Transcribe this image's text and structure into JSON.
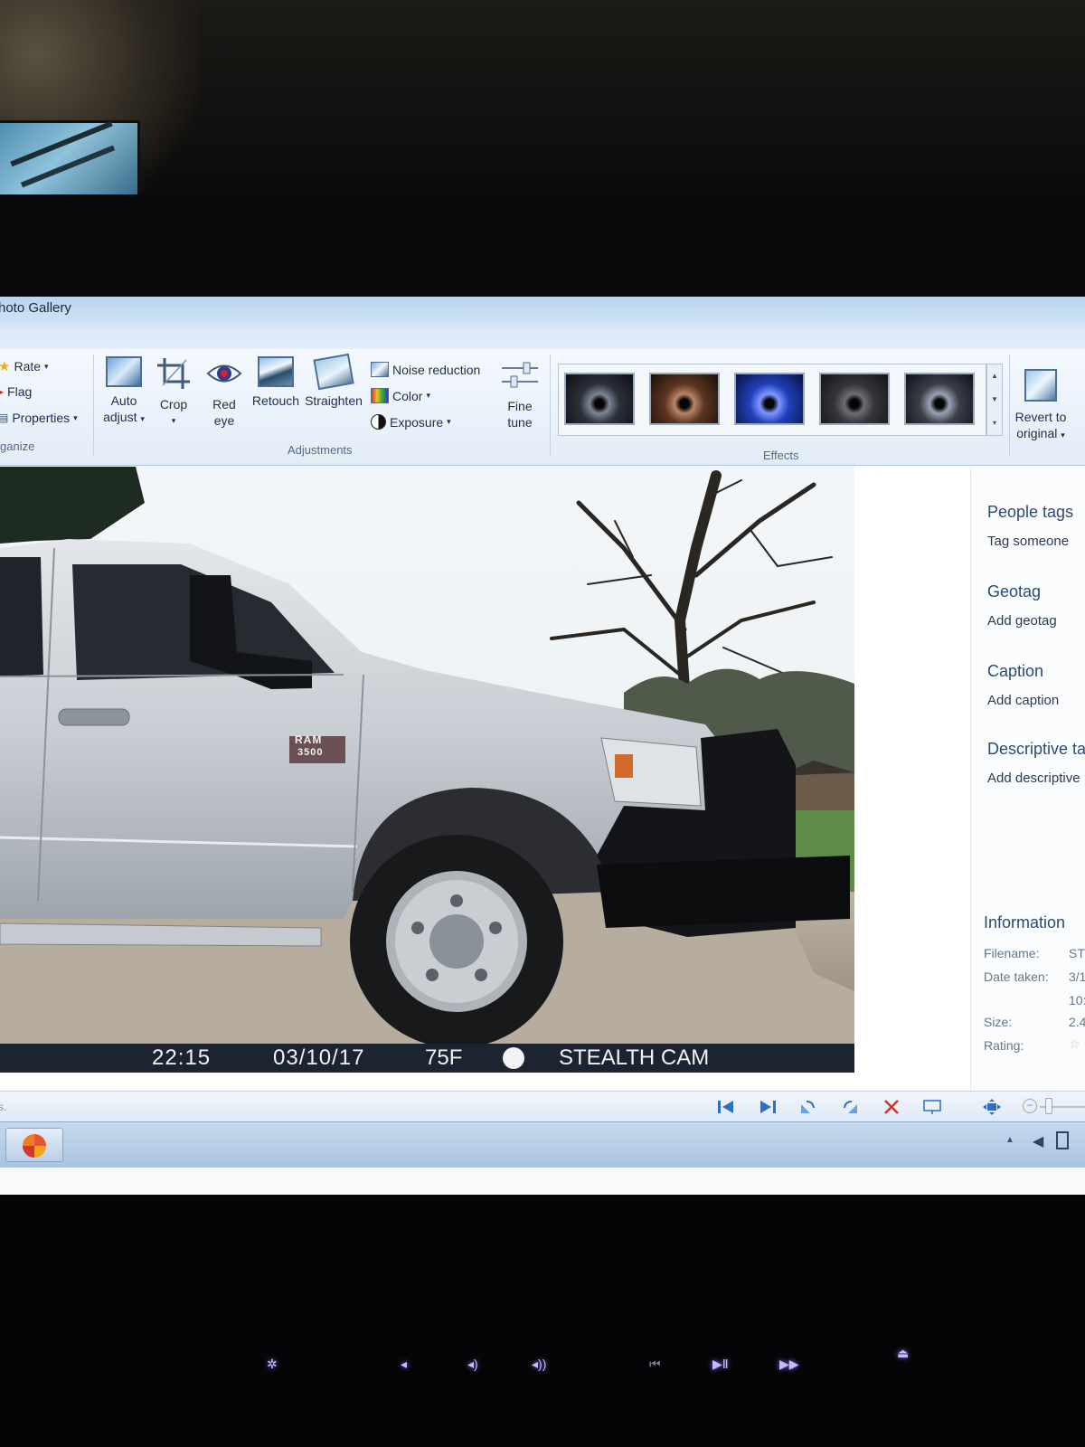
{
  "window": {
    "title": "hoto Gallery"
  },
  "ribbon": {
    "organize": {
      "rate": "Rate",
      "flag": "Flag",
      "properties": "Properties",
      "group_label": "ganize"
    },
    "adjustments": {
      "auto_adjust": [
        "Auto",
        "adjust"
      ],
      "crop": "Crop",
      "red_eye": [
        "Red",
        "eye"
      ],
      "retouch": "Retouch",
      "straighten": "Straighten",
      "noise_reduction": "Noise reduction",
      "color": "Color",
      "exposure": "Exposure",
      "fine_tune": [
        "Fine",
        "tune"
      ],
      "group_label": "Adjustments"
    },
    "effects": {
      "group_label": "Effects",
      "count": 5
    },
    "revert": [
      "Revert to",
      "original"
    ]
  },
  "photo": {
    "overlay": {
      "time": "22:15",
      "date": "03/10/17",
      "temp": "75F",
      "brand": "STEALTH CAM"
    },
    "badge": [
      "RAM",
      "3500"
    ]
  },
  "pane": {
    "people_tags": {
      "title": "People tags",
      "action": "Tag someone"
    },
    "geotag": {
      "title": "Geotag",
      "action": "Add geotag"
    },
    "caption": {
      "title": "Caption",
      "action": "Add caption"
    },
    "descriptive_tags": {
      "title": "Descriptive ta",
      "action": "Add descriptive"
    },
    "information": {
      "title": "Information",
      "filename_label": "Filename:",
      "filename_value": "ST",
      "date_label": "Date taken:",
      "date_value": "3/1",
      "time_value": "10:",
      "size_label": "Size:",
      "size_value": "2.4",
      "rating_label": "Rating:"
    }
  },
  "statusbar": {
    "text": "s."
  },
  "colors": {
    "ribbon_bg": "#e2ecf7",
    "heading": "#2d4a73",
    "overlay_bar": "#1b2430"
  }
}
